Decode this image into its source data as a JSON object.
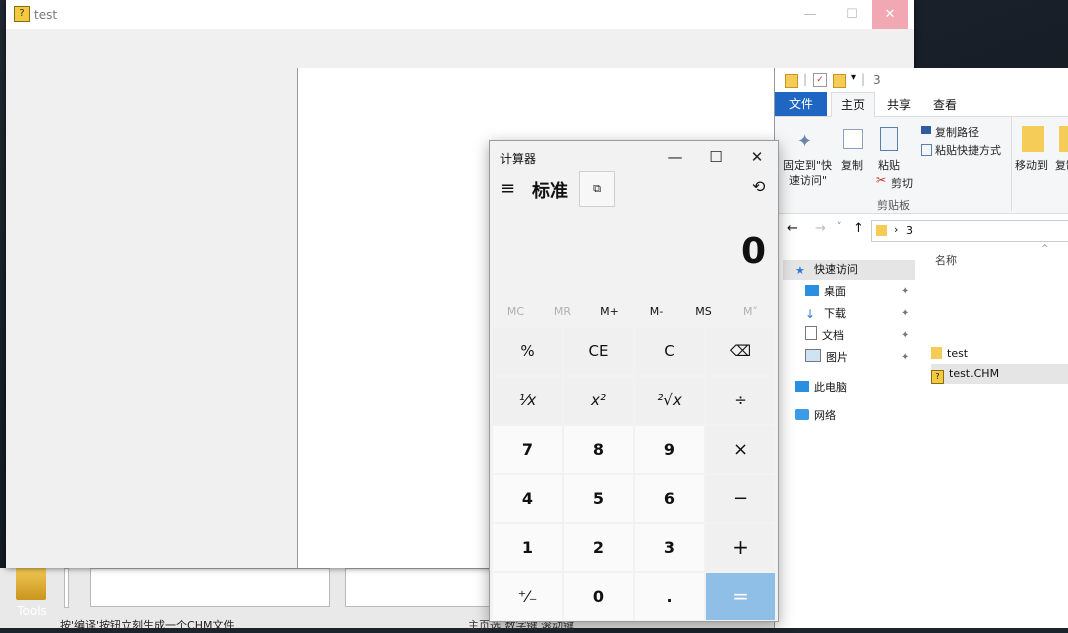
{
  "colors": {
    "accent": "#1f66c2",
    "equals_key": "#8fbee7",
    "close_hover": "#f1a8b3"
  },
  "test_window": {
    "title": "test"
  },
  "calculator": {
    "title": "计算器",
    "mode": "标准",
    "display": "0",
    "memory": [
      "MC",
      "MR",
      "M+",
      "M-",
      "MS",
      "M˅"
    ],
    "keys": [
      [
        "%",
        "CE",
        "C",
        "⌫"
      ],
      [
        "¹⁄x",
        "x²",
        "²√x",
        "÷"
      ],
      [
        "7",
        "8",
        "9",
        "×"
      ],
      [
        "4",
        "5",
        "6",
        "−"
      ],
      [
        "1",
        "2",
        "3",
        "+"
      ],
      [
        "⁺⁄₋",
        "0",
        ".",
        "="
      ]
    ]
  },
  "explorer": {
    "folder_title": "3",
    "tabs": {
      "file": "文件",
      "home": "主页",
      "share": "共享",
      "view": "查看"
    },
    "ribbon": {
      "pin_line1": "固定到\"快",
      "pin_line2": "速访问\"",
      "copy": "复制",
      "paste": "粘贴",
      "copy_path": "复制路径",
      "paste_shortcut": "粘贴快捷方式",
      "cut": "剪切",
      "clipboard_group": "剪贴板",
      "move_to": "移动到",
      "copy_to": "复制"
    },
    "address": {
      "crumb": "3"
    },
    "nav": {
      "quick_access": "快速访问",
      "desktop": "桌面",
      "downloads": "下载",
      "documents": "文档",
      "pictures": "图片",
      "this_pc": "此电脑",
      "network": "网络"
    },
    "column_name": "名称",
    "files": [
      "test",
      "test.CHM"
    ]
  },
  "desktop": {
    "tools_label": "Tools"
  },
  "status": {
    "left": "按'编译'按钮立刻生成一个CHM文件",
    "mid": "主页选 数字键 滚动键"
  }
}
